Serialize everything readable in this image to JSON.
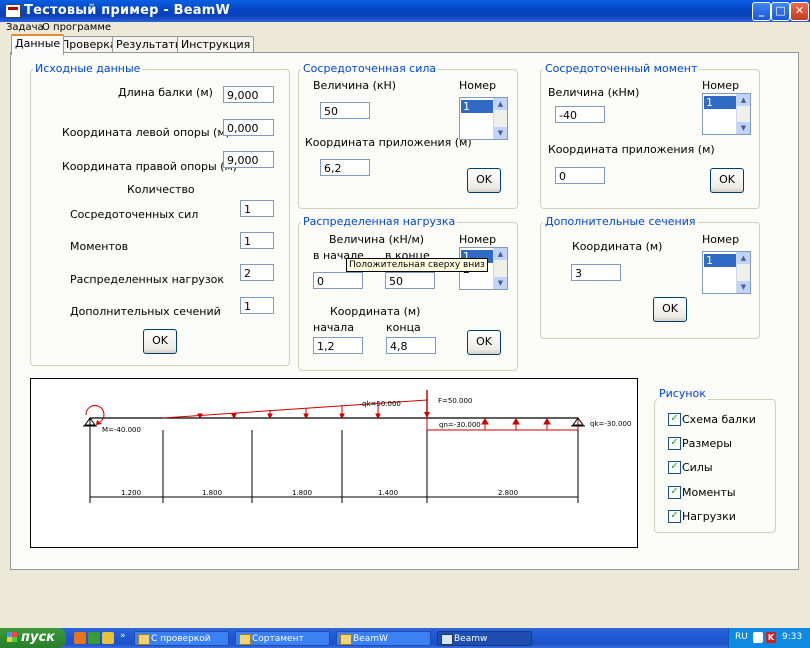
{
  "window": {
    "title": "Тестовый пример -  BeamW",
    "min_btn": "_",
    "max_btn": "□",
    "close_btn": "✕"
  },
  "menu": {
    "items": [
      "Задача",
      "О программе"
    ]
  },
  "tabs": [
    "Данные",
    "Проверка",
    "Результаты",
    "Инструкция"
  ],
  "initial": {
    "title": "Исходные данные",
    "length_label": "Длина балки (м)",
    "length_value": "9,000",
    "left_label": "Координата  левой опоры (м)",
    "left_value": "0,000",
    "right_label": "Координата правой опоры (м)",
    "right_value": "9,000",
    "count_label": "Количество",
    "forces_label": "Сосредоточенных сил",
    "forces_value": "1",
    "moments_label": "Моментов",
    "moments_value": "1",
    "loads_label": "Распределенных нагрузок",
    "loads_value": "2",
    "sections_label": "Дополнительных сечений",
    "sections_value": "1",
    "ok": "OK"
  },
  "force": {
    "title": "Сосредоточенная сила",
    "value_label": "Величина (кН)",
    "value": "50",
    "coord_label": "Координата приложения (м)",
    "coord": "6,2",
    "number_label": "Номер",
    "items": [
      "1"
    ],
    "ok": "OK"
  },
  "moment": {
    "title": "Сосредоточенный момент",
    "value_label": "Величина (кНм)",
    "value": "-40",
    "coord_label": "Координата приложения (м)",
    "coord": "0",
    "number_label": "Номер",
    "items": [
      "1"
    ],
    "ok": "OK"
  },
  "dist": {
    "title": "Распределенная нагрузка",
    "value_label": "Величина (кН/м)",
    "start_label": "в начале",
    "end_label": "в конце",
    "start_value": "0",
    "end_value": "50",
    "coord_label": "Координата (м)",
    "cstart_label": "начала",
    "cend_label": "конца",
    "cstart_value": "1,2",
    "cend_value": "4,8",
    "number_label": "Номер",
    "items": [
      "1",
      "2"
    ],
    "ok": "OK",
    "tooltip": "Положительная сверху вниз"
  },
  "sections": {
    "title": "Дополнительные сечения",
    "coord_label": "Координата (м)",
    "coord": "3",
    "number_label": "Номер",
    "items": [
      "1"
    ],
    "ok": "OK"
  },
  "diagram": {
    "labels": {
      "moment": "M=-40.000",
      "qk1": "qk=50.000",
      "force": "F=50.000",
      "qn2": "qn=-30.000",
      "qk2": "qk=-30.000"
    },
    "dims": [
      "1.200",
      "1.800",
      "1.800",
      "1.400",
      "2.800"
    ]
  },
  "picture": {
    "title": "Рисунок",
    "options": [
      {
        "label": "Схема балки",
        "checked": true
      },
      {
        "label": "Размеры",
        "checked": true
      },
      {
        "label": "Силы",
        "checked": true
      },
      {
        "label": "Моменты",
        "checked": true
      },
      {
        "label": "Нагрузки",
        "checked": true
      }
    ]
  },
  "taskbar": {
    "start": "пуск",
    "tasks": [
      "С проверкой",
      "Сортамент",
      "BeamW",
      "Beamw"
    ],
    "lang": "RU",
    "time": "9:33"
  }
}
